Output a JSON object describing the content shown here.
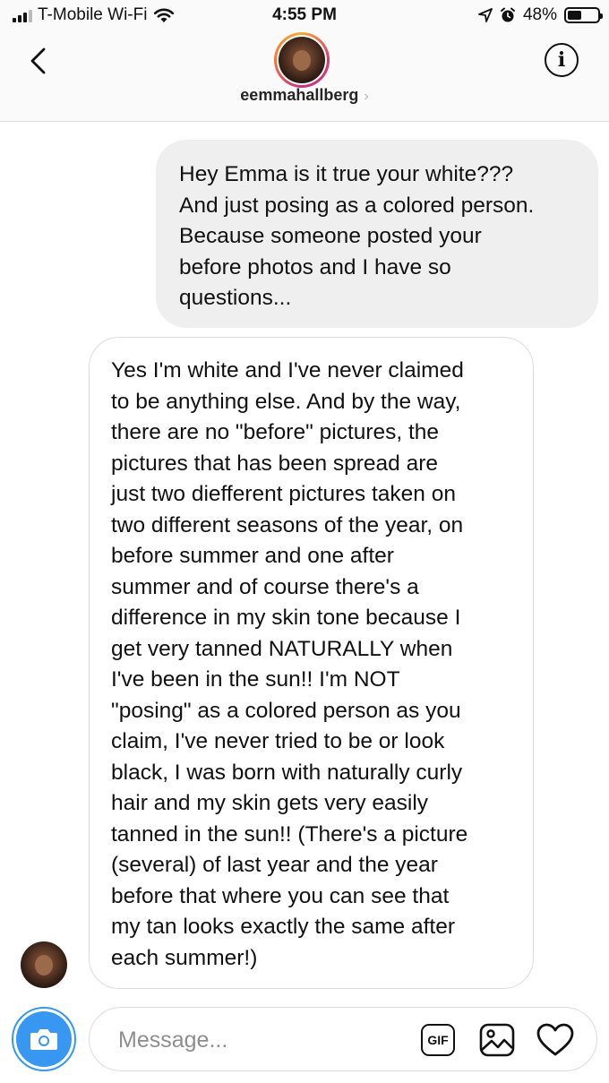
{
  "status_bar": {
    "carrier": "T-Mobile Wi-Fi",
    "time": "4:55 PM",
    "battery": "48%",
    "battery_level": 0.48
  },
  "header": {
    "username": "eemmahallberg",
    "chevron": "›",
    "info_label": "i"
  },
  "messages": {
    "outgoing": [
      "Hey Emma is it true your white???",
      "And just posing as a colored person.",
      "Because someone posted your",
      "before photos and I have so",
      "questions..."
    ],
    "incoming": [
      "Yes I'm white and I've never claimed",
      "to be anything else. And by the way,",
      "there are no \"before\" pictures, the",
      "pictures that has been spread are",
      "just two diefferent pictures taken on",
      "two different seasons of the year, on",
      "before summer and one after",
      "summer and of course there's a",
      "difference in my skin tone because I",
      "get very tanned NATURALLY when",
      "I've been in the sun!! I'm NOT",
      "\"posing\" as a colored person as you",
      "claim, I've never tried to be or look",
      "black, I was born with naturally curly",
      "hair and my skin gets very easily",
      "tanned in the sun!! (There's a picture",
      "(several) of last year and the year",
      "before that where you can see that",
      "my tan looks exactly the same after",
      "each summer!)"
    ]
  },
  "composer": {
    "placeholder": "Message...",
    "value": "",
    "gif_label": "GIF"
  }
}
